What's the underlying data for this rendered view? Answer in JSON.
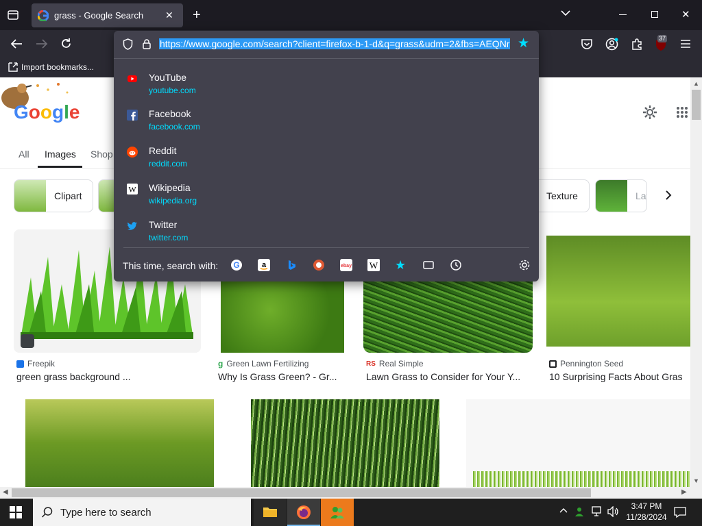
{
  "browser": {
    "tab_title": "grass - Google Search",
    "url": "https://www.google.com/search?client=firefox-b-1-d&q=grass&udm=2&fbs=AEQNr",
    "bookmarks_label": "Import bookmarks...",
    "extensions_badge": "37"
  },
  "google": {
    "nav_tabs": [
      "All",
      "Images",
      "Shop"
    ],
    "chips": [
      "Clipart",
      "Texture",
      "Lawn"
    ],
    "results_row1": [
      {
        "source": "Freepik",
        "caption": "green grass background ..."
      },
      {
        "source": "Green Lawn Fertilizing",
        "caption": "Why Is Grass Green? - Gr..."
      },
      {
        "source": "Real Simple",
        "source_badge": "RS",
        "caption": "Lawn Grass to Consider for Your Y..."
      },
      {
        "source": "Pennington Seed",
        "caption": "10 Surprising Facts About Gras"
      }
    ]
  },
  "dropdown": {
    "suggestions": [
      {
        "name": "YouTube",
        "url": "youtube.com",
        "icon": "youtube-icon",
        "color": "#ff0000"
      },
      {
        "name": "Facebook",
        "url": "facebook.com",
        "icon": "facebook-icon",
        "color": "#3b5998"
      },
      {
        "name": "Reddit",
        "url": "reddit.com",
        "icon": "reddit-icon",
        "color": "#ff4500"
      },
      {
        "name": "Wikipedia",
        "url": "wikipedia.org",
        "icon": "wikipedia-icon",
        "color": "#ffffff"
      },
      {
        "name": "Twitter",
        "url": "twitter.com",
        "icon": "twitter-icon",
        "color": "#1da1f2"
      }
    ],
    "search_with_label": "This time, search with:",
    "engines": [
      "google-icon",
      "amazon-icon",
      "bing-icon",
      "duckduckgo-icon",
      "ebay-icon",
      "wikipedia-icon",
      "bookmarks-star-icon",
      "tabs-icon",
      "history-icon"
    ]
  },
  "taskbar": {
    "search_placeholder": "Type here to search",
    "time": "3:47 PM",
    "date": "11/28/2024"
  },
  "colors": {
    "accent": "#00ddff",
    "selection": "#2d9af5",
    "frame": "#1c1b22",
    "toolbar": "#2b2a33",
    "panel": "#42414d"
  }
}
